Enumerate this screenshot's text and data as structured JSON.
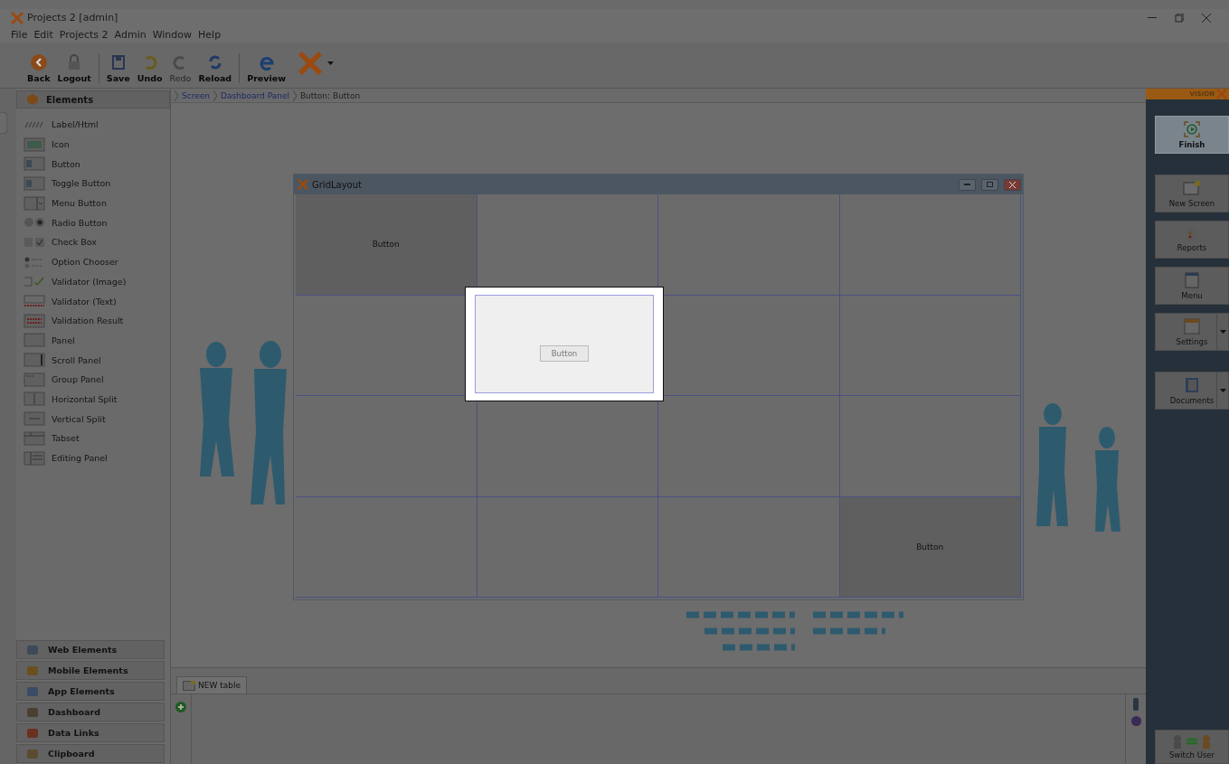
{
  "window": {
    "title": "Projects 2 [admin]"
  },
  "menu": [
    "File",
    "Edit",
    "Projects 2",
    "Admin",
    "Window",
    "Help"
  ],
  "toolbar": [
    {
      "kind": "back",
      "label": "Back",
      "disabled": false,
      "group_start": false
    },
    {
      "kind": "logout",
      "label": "Logout",
      "disabled": false,
      "group_start": false
    },
    {
      "kind": "save",
      "label": "Save",
      "disabled": false,
      "group_start": true
    },
    {
      "kind": "undo",
      "label": "Undo",
      "disabled": false,
      "group_start": false
    },
    {
      "kind": "redo",
      "label": "Redo",
      "disabled": true,
      "group_start": false
    },
    {
      "kind": "reload",
      "label": "Reload",
      "disabled": false,
      "group_start": false
    },
    {
      "kind": "preview",
      "label": "Preview",
      "disabled": false,
      "group_start": true
    }
  ],
  "breadcrumb": [
    {
      "label": "Screen",
      "link": true
    },
    {
      "label": "Dashboard Panel",
      "link": true
    },
    {
      "label": "Button: Button",
      "link": false
    }
  ],
  "sidebar": {
    "title": "Elements",
    "items": [
      {
        "kind": "label",
        "label": "Label/Html"
      },
      {
        "kind": "icon",
        "label": "Icon"
      },
      {
        "kind": "button",
        "label": "Button"
      },
      {
        "kind": "toggle",
        "label": "Toggle Button"
      },
      {
        "kind": "menu",
        "label": "Menu Button"
      },
      {
        "kind": "radio",
        "label": "Radio Button"
      },
      {
        "kind": "check",
        "label": "Check Box"
      },
      {
        "kind": "option",
        "label": "Option Chooser"
      },
      {
        "kind": "valimage",
        "label": "Validator (Image)"
      },
      {
        "kind": "valtext",
        "label": "Validator (Text)"
      },
      {
        "kind": "valresult",
        "label": "Validation Result"
      },
      {
        "kind": "panel",
        "label": "Panel"
      },
      {
        "kind": "scroll",
        "label": "Scroll Panel"
      },
      {
        "kind": "group",
        "label": "Group Panel"
      },
      {
        "kind": "hsplit",
        "label": "Horizontal Split"
      },
      {
        "kind": "vsplit",
        "label": "Vertical Split"
      },
      {
        "kind": "tabset",
        "label": "Tabset"
      },
      {
        "kind": "editing",
        "label": "Editing Panel"
      }
    ],
    "categories": [
      {
        "kind": "web",
        "label": "Web Elements"
      },
      {
        "kind": "mobile",
        "label": "Mobile Elements"
      },
      {
        "kind": "app",
        "label": "App Elements"
      },
      {
        "kind": "dashboard",
        "label": "Dashboard"
      },
      {
        "kind": "datalinks",
        "label": "Data Links"
      },
      {
        "kind": "clipboard",
        "label": "Clipboard"
      }
    ]
  },
  "grid_window": {
    "title": "GridLayout",
    "rows": [
      [
        {
          "kind": "button",
          "label": "Button"
        },
        {
          "kind": "empty"
        },
        {
          "kind": "empty"
        },
        {
          "kind": "empty"
        }
      ],
      [
        {
          "kind": "empty"
        },
        {
          "kind": "empty"
        },
        {
          "kind": "empty"
        },
        {
          "kind": "empty"
        }
      ],
      [
        {
          "kind": "empty"
        },
        {
          "kind": "empty"
        },
        {
          "kind": "empty"
        },
        {
          "kind": "empty"
        }
      ],
      [
        {
          "kind": "empty"
        },
        {
          "kind": "empty"
        },
        {
          "kind": "empty"
        },
        {
          "kind": "button",
          "label": "Button"
        }
      ]
    ],
    "spotlight": {
      "button_label": "Button"
    }
  },
  "bottom_tabs": [
    {
      "label": "NEW table",
      "selected": true
    }
  ],
  "right_panel": {
    "brand": "VISION",
    "buttons": [
      {
        "kind": "finish",
        "label": "Finish",
        "selected": true,
        "has_menu": false
      },
      {
        "kind": "newscreen",
        "label": "New Screen",
        "selected": false,
        "has_menu": false
      },
      {
        "kind": "reports",
        "label": "Reports",
        "selected": false,
        "has_menu": false
      },
      {
        "kind": "menu",
        "label": "Menu",
        "selected": false,
        "has_menu": false
      },
      {
        "kind": "settings",
        "label": "Settings",
        "selected": false,
        "has_menu": true
      },
      {
        "kind": "documents",
        "label": "Documents",
        "selected": false,
        "has_menu": true
      }
    ],
    "switch_user": "Switch User"
  }
}
